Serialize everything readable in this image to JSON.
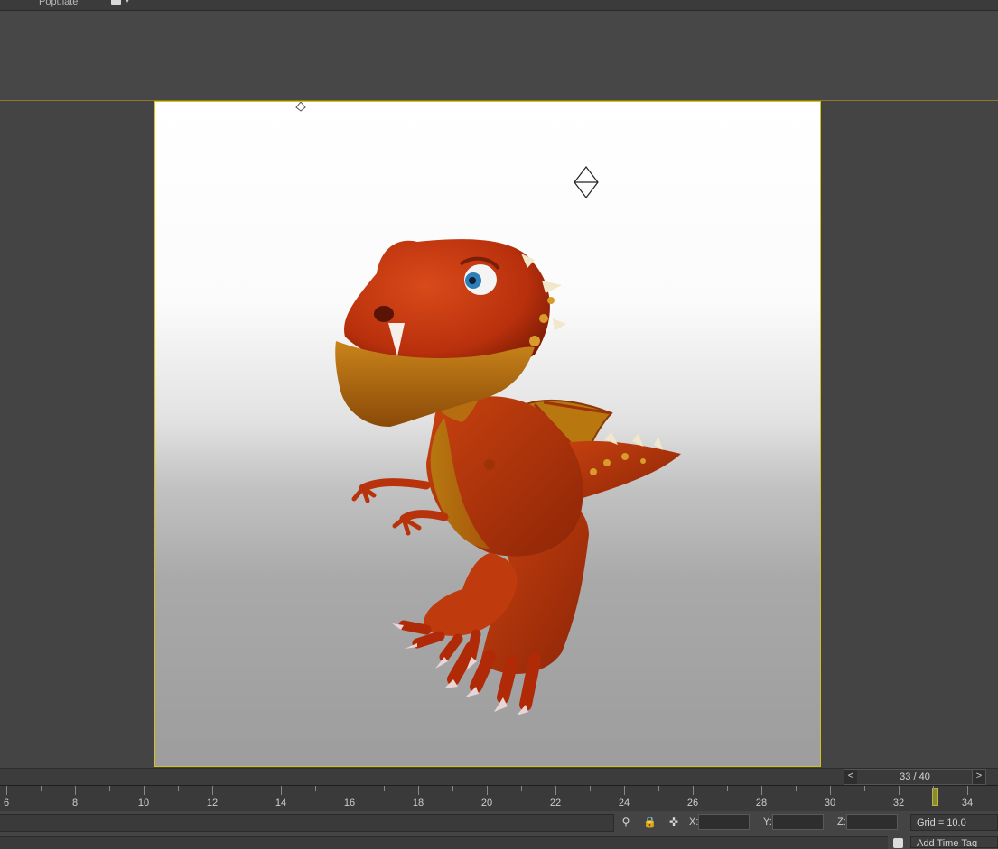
{
  "toolbar": {
    "populate_label": "Populate",
    "tool_icon": "object-paint-icon",
    "dropdown_icon": "chevron-down-icon"
  },
  "frame_slider": {
    "prev_label": "<",
    "next_label": ">",
    "label": "33 / 40",
    "current_frame": 33,
    "total_frames": 40
  },
  "time_ruler": {
    "labels": [
      "6",
      "8",
      "10",
      "12",
      "14",
      "16",
      "18",
      "20",
      "22",
      "24",
      "26",
      "28",
      "30",
      "32",
      "34"
    ]
  },
  "status": {
    "prompt_text": "",
    "icons": [
      "key-filter-icon",
      "lock-selection-icon",
      "absolute-transform-icon"
    ],
    "x_label": "X:",
    "y_label": "Y:",
    "z_label": "Z:",
    "x_value": "",
    "y_value": "",
    "z_value": "",
    "grid_label": "Grid = 10.0",
    "add_time_tag_label": "Add Time Tag"
  },
  "colors": {
    "frame_border": "#d2c21a",
    "dragon_body": "#c43a0e",
    "dragon_belly": "#c07010",
    "time_marker": "#8c8a2a"
  }
}
